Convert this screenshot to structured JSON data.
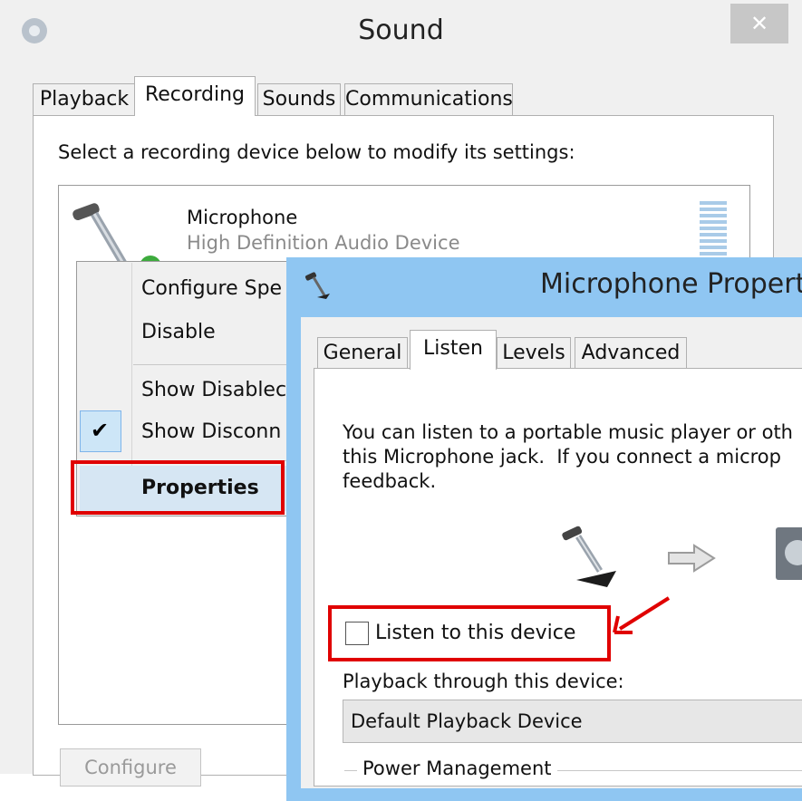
{
  "sound_window": {
    "title": "Sound",
    "close_glyph": "✕",
    "tabs": [
      "Playback",
      "Recording",
      "Sounds",
      "Communications"
    ],
    "active_tab": "Recording",
    "instruction": "Select a recording device below to modify its settings:",
    "device": {
      "name": "Microphone",
      "subtitle": "High Definition Audio Device",
      "icon": "microphone-icon"
    },
    "configure_label": "Configure"
  },
  "context_menu": {
    "items": {
      "configure_speech": "Configure Spe",
      "disable": "Disable",
      "show_disabled": "Show Disablec",
      "show_disconnected": "Show Disconn",
      "properties": "Properties"
    },
    "checkmark_glyph": "✔"
  },
  "mic_dialog": {
    "title": "Microphone Properti",
    "tabs": [
      "General",
      "Listen",
      "Levels",
      "Advanced"
    ],
    "active_tab": "Listen",
    "description": "You can listen to a portable music player or oth\nthis Microphone jack.  If you connect a microp\nfeedback.",
    "listen_checkbox_label": "Listen to this device",
    "listen_checked": false,
    "playback_label": "Playback through this device:",
    "playback_value": "Default Playback Device",
    "power_group_label": "Power Management"
  },
  "colors": {
    "highlight_red": "#e00000",
    "dialog_title_blue": "#8fc6f2",
    "menu_highlight": "#d6e6f3"
  }
}
